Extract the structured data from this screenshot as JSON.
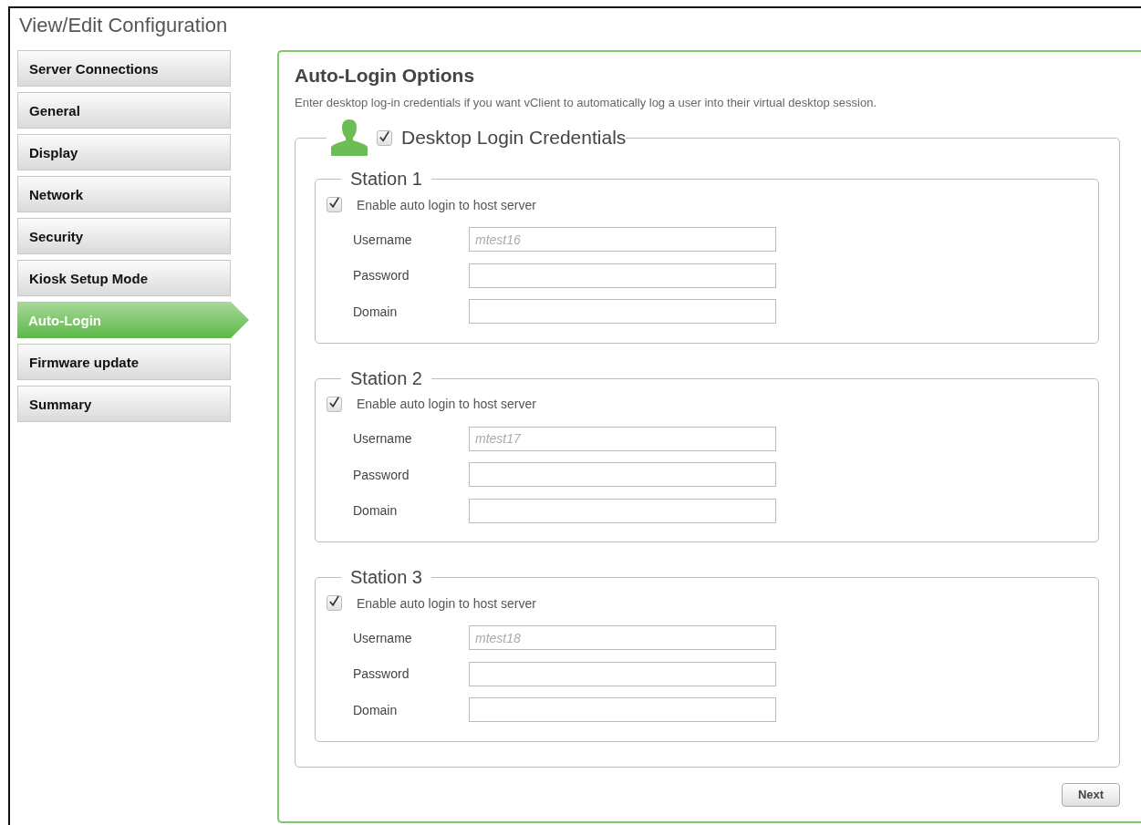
{
  "window": {
    "title": "View/Edit Configuration"
  },
  "sidebar": {
    "items": [
      {
        "label": "Server Connections",
        "selected": false
      },
      {
        "label": "General",
        "selected": false
      },
      {
        "label": "Display",
        "selected": false
      },
      {
        "label": "Network",
        "selected": false
      },
      {
        "label": "Security",
        "selected": false
      },
      {
        "label": "Kiosk Setup Mode",
        "selected": false
      },
      {
        "label": "Auto-Login",
        "selected": true
      },
      {
        "label": "Firmware update",
        "selected": false
      },
      {
        "label": "Summary",
        "selected": false
      }
    ]
  },
  "panel": {
    "title": "Auto-Login Options",
    "description": "Enter desktop log-in credentials if you want vClient to automatically log a user into their virtual desktop session.",
    "credentials": {
      "label": "Desktop Login Credentials",
      "checked": true,
      "stations": [
        {
          "title": "Station 1",
          "enable_label": "Enable auto login to host server",
          "checked": true,
          "fields": [
            {
              "label": "Username",
              "placeholder": "mtest16"
            },
            {
              "label": "Password"
            },
            {
              "label": "Domain"
            }
          ]
        },
        {
          "title": "Station 2",
          "enable_label": "Enable auto login to host server",
          "checked": true,
          "fields": [
            {
              "label": "Username",
              "placeholder": "mtest17"
            },
            {
              "label": "Password"
            },
            {
              "label": "Domain"
            }
          ]
        },
        {
          "title": "Station 3",
          "enable_label": "Enable auto login to host server",
          "checked": true,
          "fields": [
            {
              "label": "Username",
              "placeholder": "mtest18"
            },
            {
              "label": "Password"
            },
            {
              "label": "Domain"
            }
          ]
        }
      ]
    },
    "buttons": [
      {
        "label": "Next"
      }
    ]
  }
}
